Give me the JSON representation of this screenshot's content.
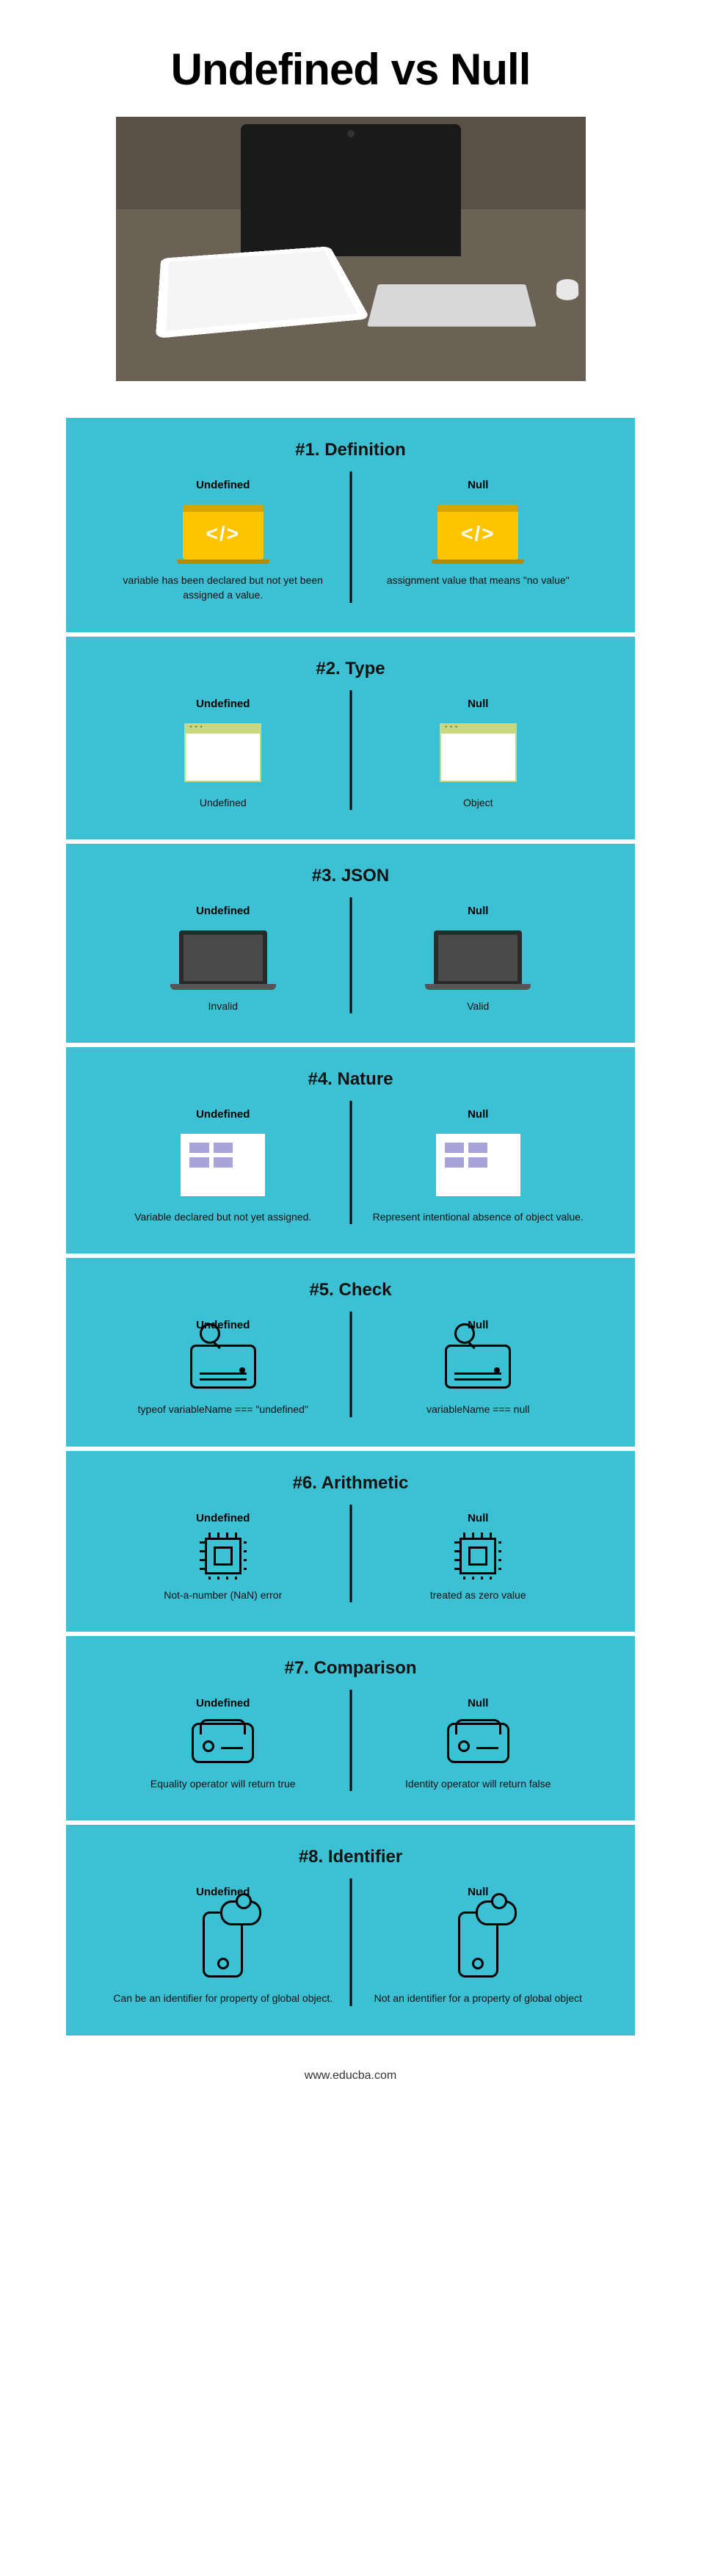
{
  "title": "Undefined vs Null",
  "footer": "www.educba.com",
  "labels": {
    "undefined": "Undefined",
    "null": "Null"
  },
  "sections": [
    {
      "header": "#1. Definition",
      "icon": "laptop-yellow",
      "undefined_desc": "variable has been declared but not yet been assigned a value.",
      "null_desc": "assignment value that means \"no value\""
    },
    {
      "header": "#2. Type",
      "icon": "browser-window",
      "undefined_desc": "Undefined",
      "null_desc": "Object"
    },
    {
      "header": "#3. JSON",
      "icon": "laptop-dark",
      "undefined_desc": "Invalid",
      "null_desc": "Valid"
    },
    {
      "header": "#4. Nature",
      "icon": "grid-card",
      "undefined_desc": "Variable declared but not yet assigned.",
      "null_desc": "Represent intentional absence of object value."
    },
    {
      "header": "#5. Check",
      "icon": "hdd-search",
      "undefined_desc": "typeof variableName === \"undefined\"",
      "null_desc": "variableName === null"
    },
    {
      "header": "#6. Arithmetic",
      "icon": "chip-icon",
      "undefined_desc": "Not-a-number (NaN) error",
      "null_desc": "treated as zero value"
    },
    {
      "header": "#7. Comparison",
      "icon": "drives-icon",
      "undefined_desc": "Equality operator will return true",
      "null_desc": "Identity operator will return false"
    },
    {
      "header": "#8. Identifier",
      "icon": "phone-cloud",
      "undefined_desc": "Can be an identifier for property of global object.",
      "null_desc": "Not an identifier for a property of global object"
    }
  ]
}
